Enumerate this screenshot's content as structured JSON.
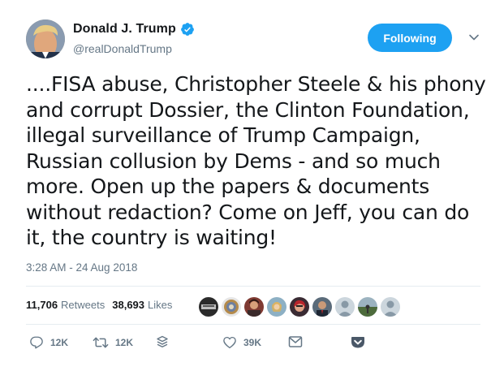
{
  "user": {
    "display_name": "Donald J. Trump",
    "handle": "@realDonaldTrump",
    "verified": true
  },
  "follow_button": {
    "label": "Following"
  },
  "tweet": {
    "lines": [
      "....FISA abuse, Christopher Steele & his phony",
      "and corrupt Dossier, the Clinton Foundation,",
      "illegal surveillance of Trump Campaign,",
      "Russian collusion by Dems - and so much",
      "more. Open up the papers & documents",
      "without redaction? Come on Jeff, you can do",
      "it, the country is waiting!"
    ],
    "timestamp": "3:28 AM - 24 Aug 2018"
  },
  "stats": {
    "retweets_count": "11,706",
    "retweets_label": "Retweets",
    "likes_count": "38,693",
    "likes_label": "Likes"
  },
  "actions": {
    "reply_count": "12K",
    "retweet_count": "12K",
    "like_count": "39K"
  },
  "icons": {
    "verified": "verified-badge-icon",
    "caret": "chevron-down-icon",
    "reply": "reply-icon",
    "retweet": "retweet-icon",
    "stack": "stack-icon",
    "like": "heart-icon",
    "message": "envelope-icon",
    "pocket": "pocket-icon"
  },
  "colors": {
    "brand_blue": "#1da1f2",
    "muted_text": "#657786",
    "primary_text": "#14171a",
    "divider": "#e6ecf0",
    "pocket_red": "#ef4056"
  }
}
